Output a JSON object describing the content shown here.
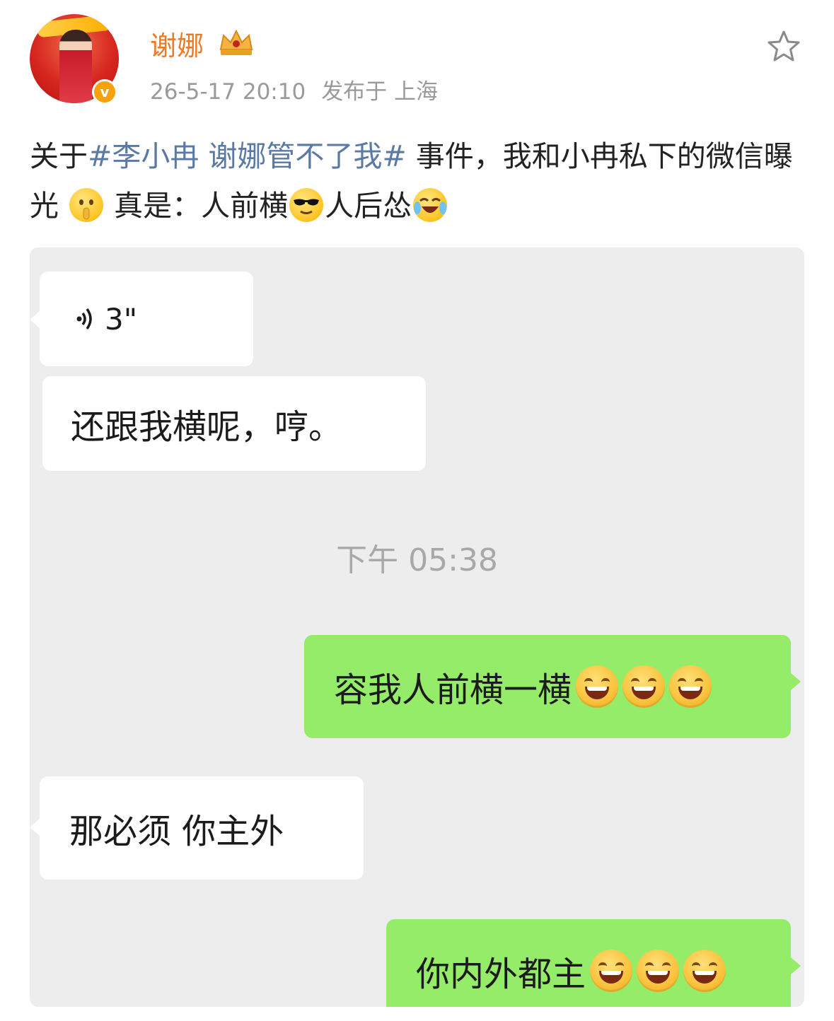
{
  "post": {
    "author": "谢娜",
    "date": "26-5-17 20:10",
    "location": "发布于 上海",
    "text_prefix": "关于",
    "topic": "#李小冉 谢娜管不了我#",
    "text_middle": " 事件，我和小冉私下的微信曝光",
    "text_tail_1": " 真是：人前横",
    "text_tail_2": "人后怂",
    "icons": {
      "avatar": "user-avatar",
      "verified": "verified-badge-icon",
      "member": "member-crown-icon",
      "favorite": "star-icon",
      "emoji_1": "shush-emoji",
      "emoji_2": "cool-sunglasses-emoji",
      "emoji_3": "laugh-crying-emoji"
    },
    "colors": {
      "author": "#ec7a24",
      "topic": "#5a79a5"
    }
  },
  "chat": {
    "voice_duration": "3\"",
    "msg_in_1": "还跟我横呢，哼。",
    "timestamp": "下午 05:38",
    "msg_out_1": "容我人前横一横",
    "msg_in_2": "那必须 你主外",
    "msg_out_2": "你内外都主",
    "colors": {
      "bg": "#ededed",
      "in": "#ffffff",
      "out": "#95ec69"
    }
  }
}
